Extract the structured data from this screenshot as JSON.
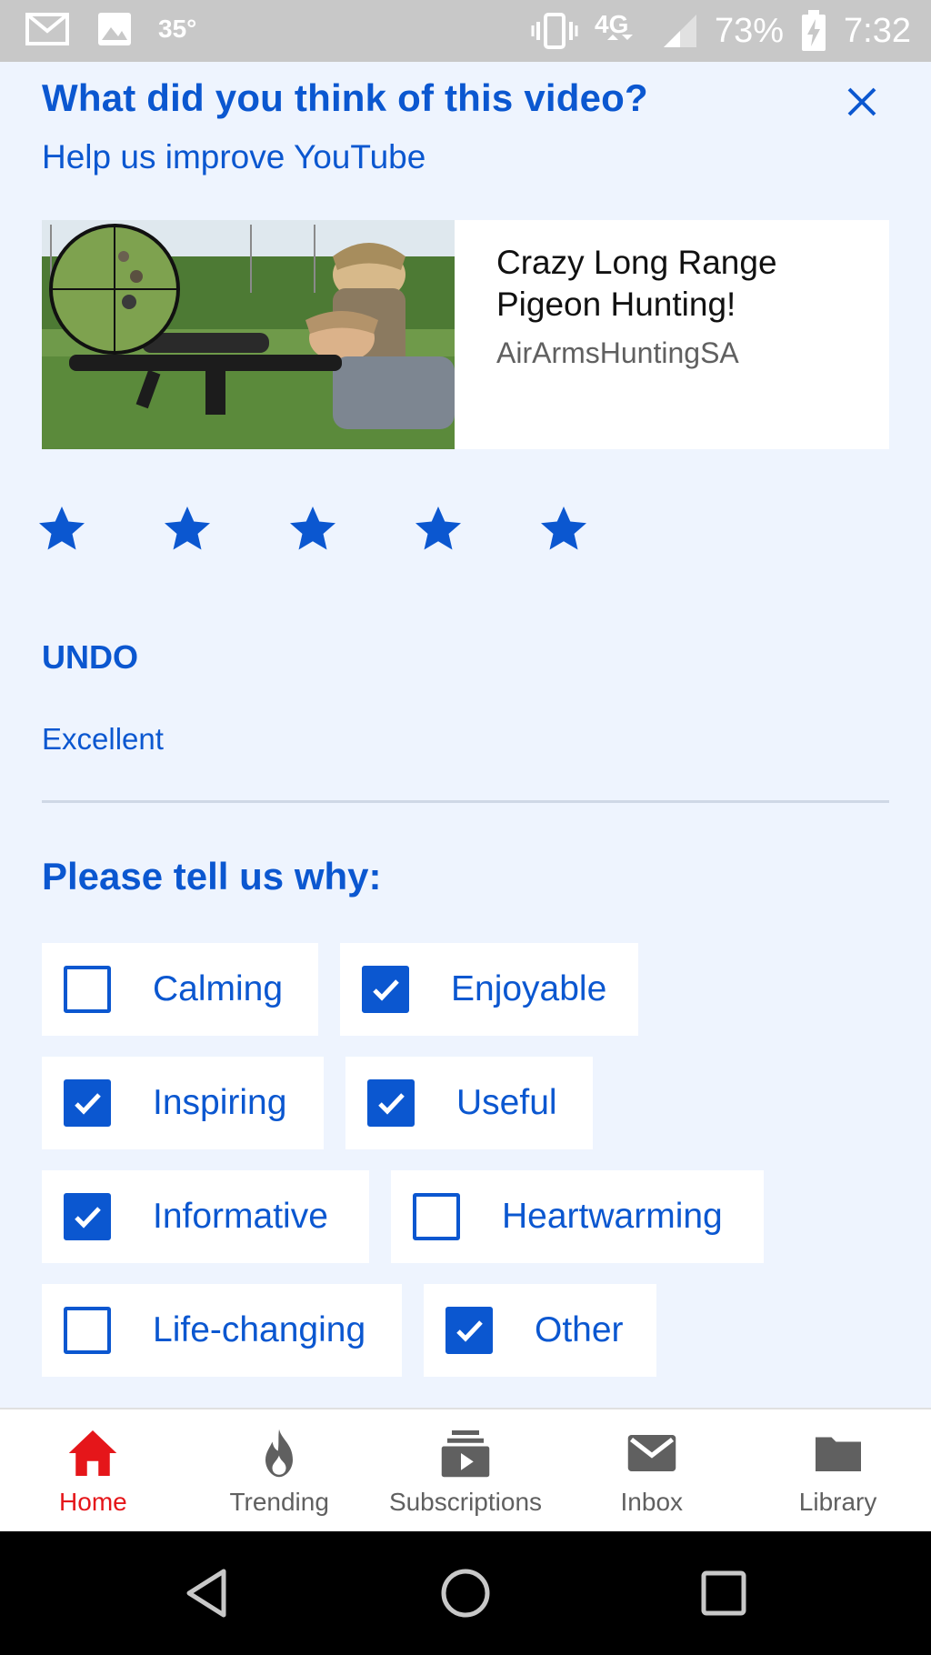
{
  "status_bar": {
    "temperature": "35°",
    "battery": "73%",
    "time": "7:32",
    "icons": [
      "gmail-icon",
      "image-icon",
      "vibrate-icon",
      "4g-lte-icon",
      "signal-icon",
      "battery-charging-icon"
    ]
  },
  "feedback": {
    "title": "What did you think of this video?",
    "subtitle": "Help us improve YouTube",
    "close_icon": "close-icon",
    "video": {
      "title": "Crazy Long Range Pigeon Hunting!",
      "channel": "AirArmsHuntingSA"
    },
    "rating": {
      "stars_selected": 5,
      "stars_total": 5,
      "label": "Excellent"
    },
    "undo_label": "UNDO",
    "why_title": "Please tell us why:",
    "reasons": [
      {
        "label": "Calming",
        "checked": false
      },
      {
        "label": "Enjoyable",
        "checked": true
      },
      {
        "label": "Inspiring",
        "checked": true
      },
      {
        "label": "Useful",
        "checked": true
      },
      {
        "label": "Informative",
        "checked": true
      },
      {
        "label": "Heartwarming",
        "checked": false
      },
      {
        "label": "Life-changing",
        "checked": false
      },
      {
        "label": "Other",
        "checked": true
      }
    ]
  },
  "bottom_nav": {
    "items": [
      {
        "label": "Home",
        "icon": "home-icon",
        "active": true
      },
      {
        "label": "Trending",
        "icon": "flame-icon",
        "active": false
      },
      {
        "label": "Subscriptions",
        "icon": "subscriptions-icon",
        "active": false
      },
      {
        "label": "Inbox",
        "icon": "mail-icon",
        "active": false
      },
      {
        "label": "Library",
        "icon": "folder-icon",
        "active": false
      }
    ]
  },
  "colors": {
    "accent": "#0b57d0",
    "active_nav": "#e5161a",
    "panel_bg": "#eef4fe"
  }
}
